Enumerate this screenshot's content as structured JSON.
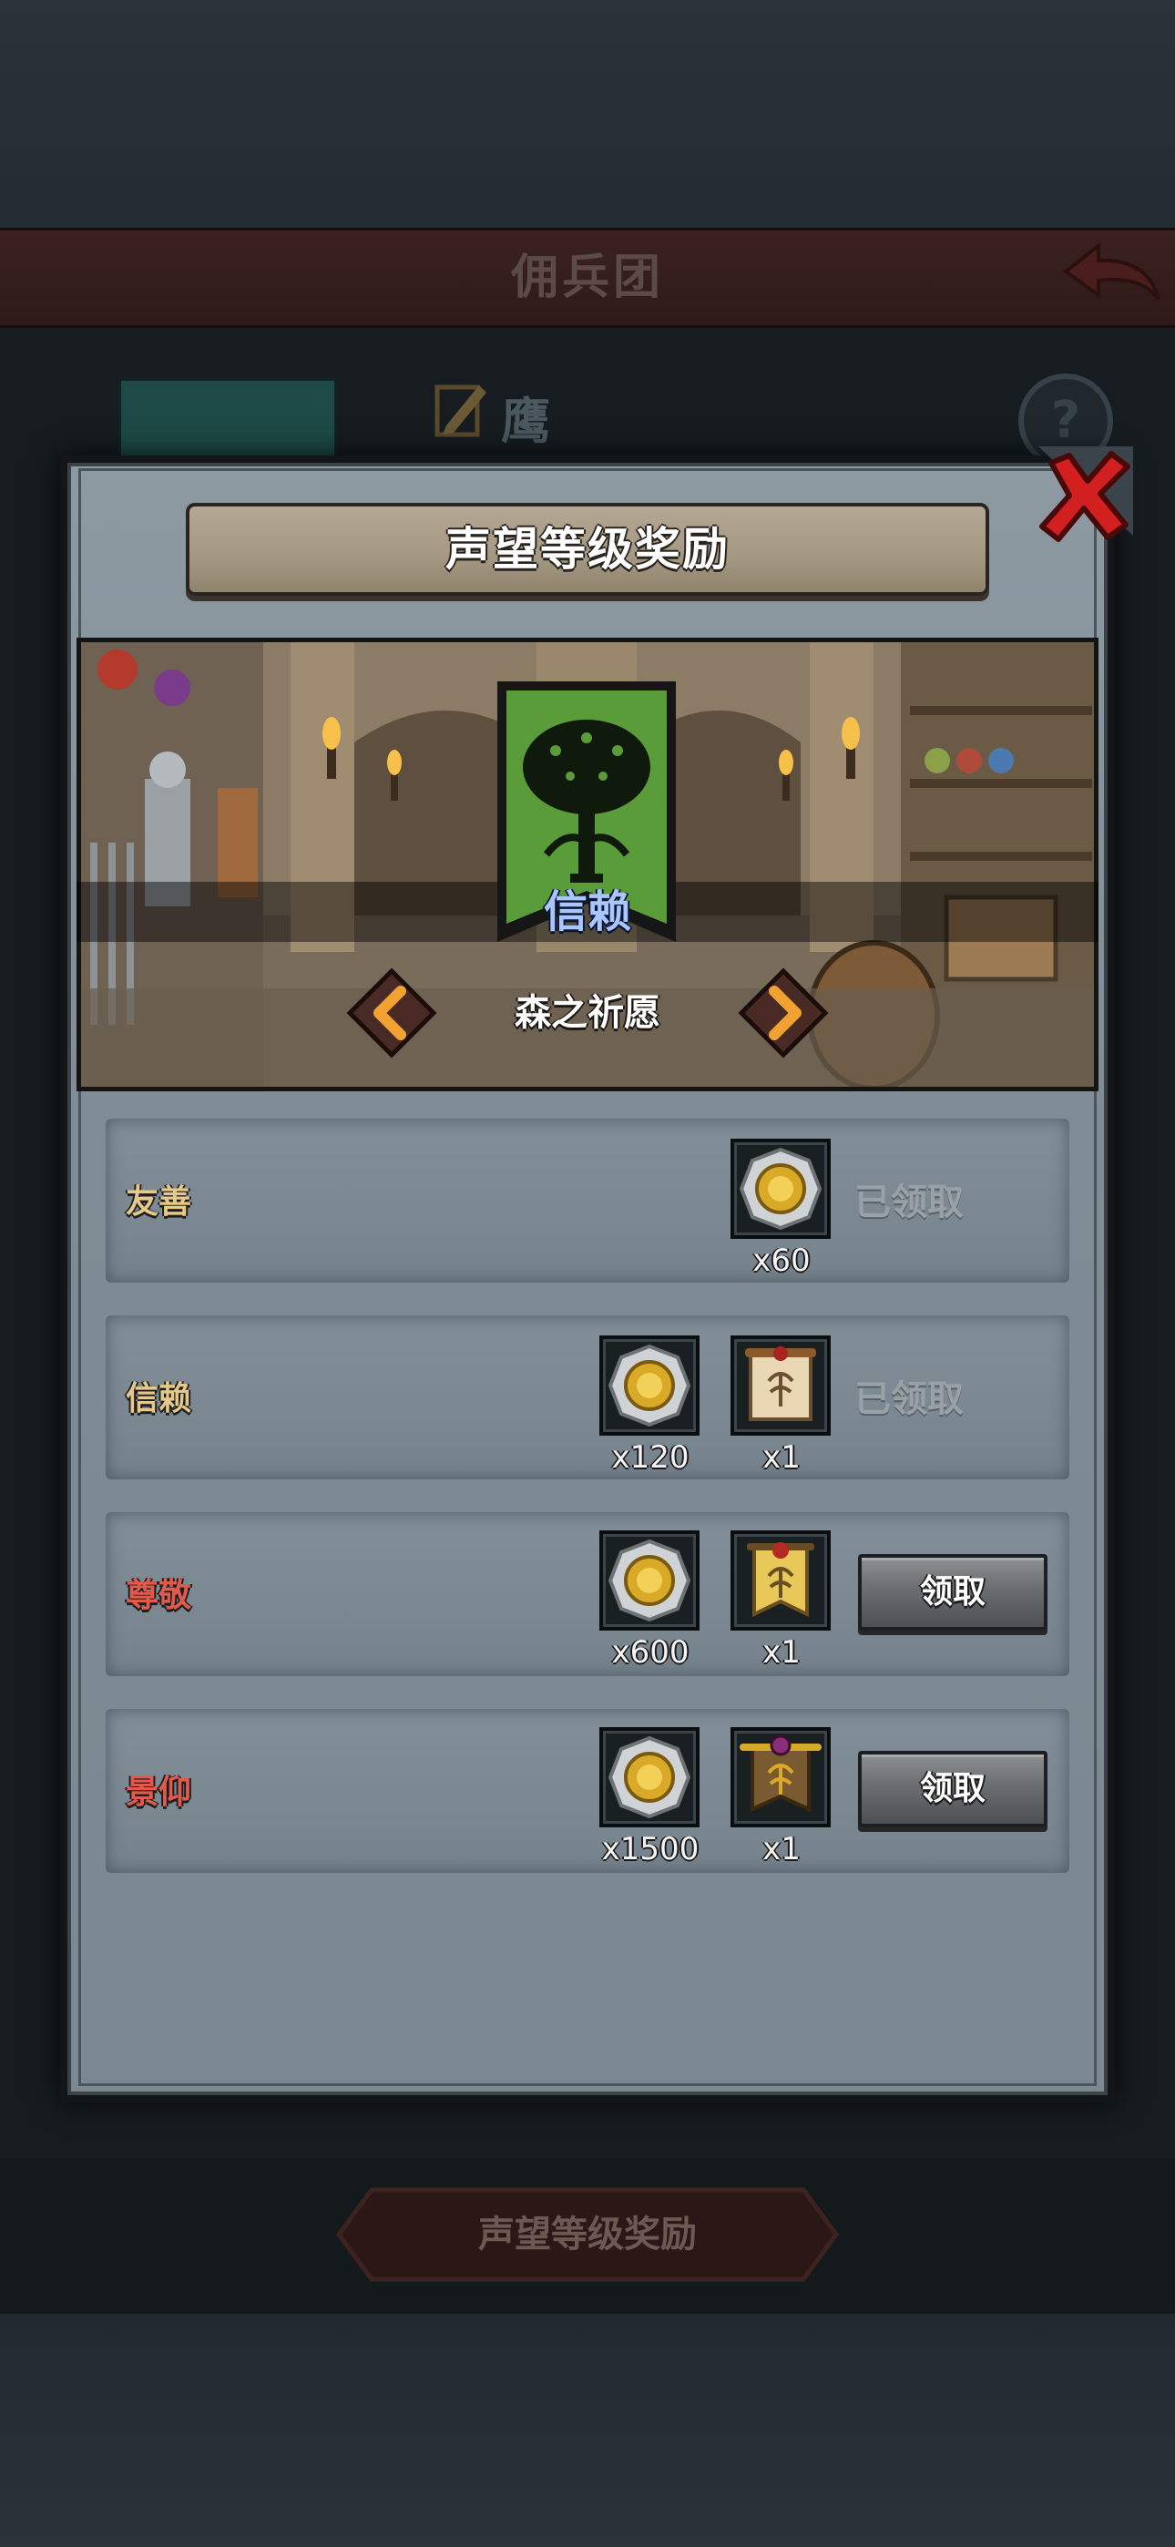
{
  "background": {
    "header_title": "佣兵团",
    "tab_name": "鹰",
    "help_symbol": "?",
    "footer_button_label": "声望等级奖励"
  },
  "modal": {
    "title": "声望等级奖励",
    "current_rank": "信赖",
    "faction_name": "森之祈愿",
    "rows": [
      {
        "rank": "友善",
        "rank_color": "#e6c98a",
        "rewards": [
          {
            "icon": "silver-gold-coin-icon",
            "count": "x60"
          }
        ],
        "status": "已领取"
      },
      {
        "rank": "信赖",
        "rank_color": "#e6c98a",
        "rewards": [
          {
            "icon": "silver-gold-coin-icon",
            "count": "x120"
          },
          {
            "icon": "tree-scroll-icon",
            "count": "x1"
          }
        ],
        "status": "已领取"
      },
      {
        "rank": "尊敬",
        "rank_color": "#e05a4e",
        "rewards": [
          {
            "icon": "silver-gold-coin-icon",
            "count": "x600"
          },
          {
            "icon": "tree-banner-icon",
            "count": "x1"
          }
        ],
        "button": "领取"
      },
      {
        "rank": "景仰",
        "rank_color": "#e05a4e",
        "rewards": [
          {
            "icon": "silver-gold-coin-icon",
            "count": "x1500"
          },
          {
            "icon": "ornate-tree-banner-icon",
            "count": "x1"
          }
        ],
        "button": "领取"
      }
    ]
  },
  "colors": {
    "panel": "#7f8c95",
    "rank_highlight": "#a9c6ff",
    "emblem_green": "#5a9b3a",
    "claimable_rank": "#e05a4e",
    "claimed_rank": "#e6c98a"
  }
}
